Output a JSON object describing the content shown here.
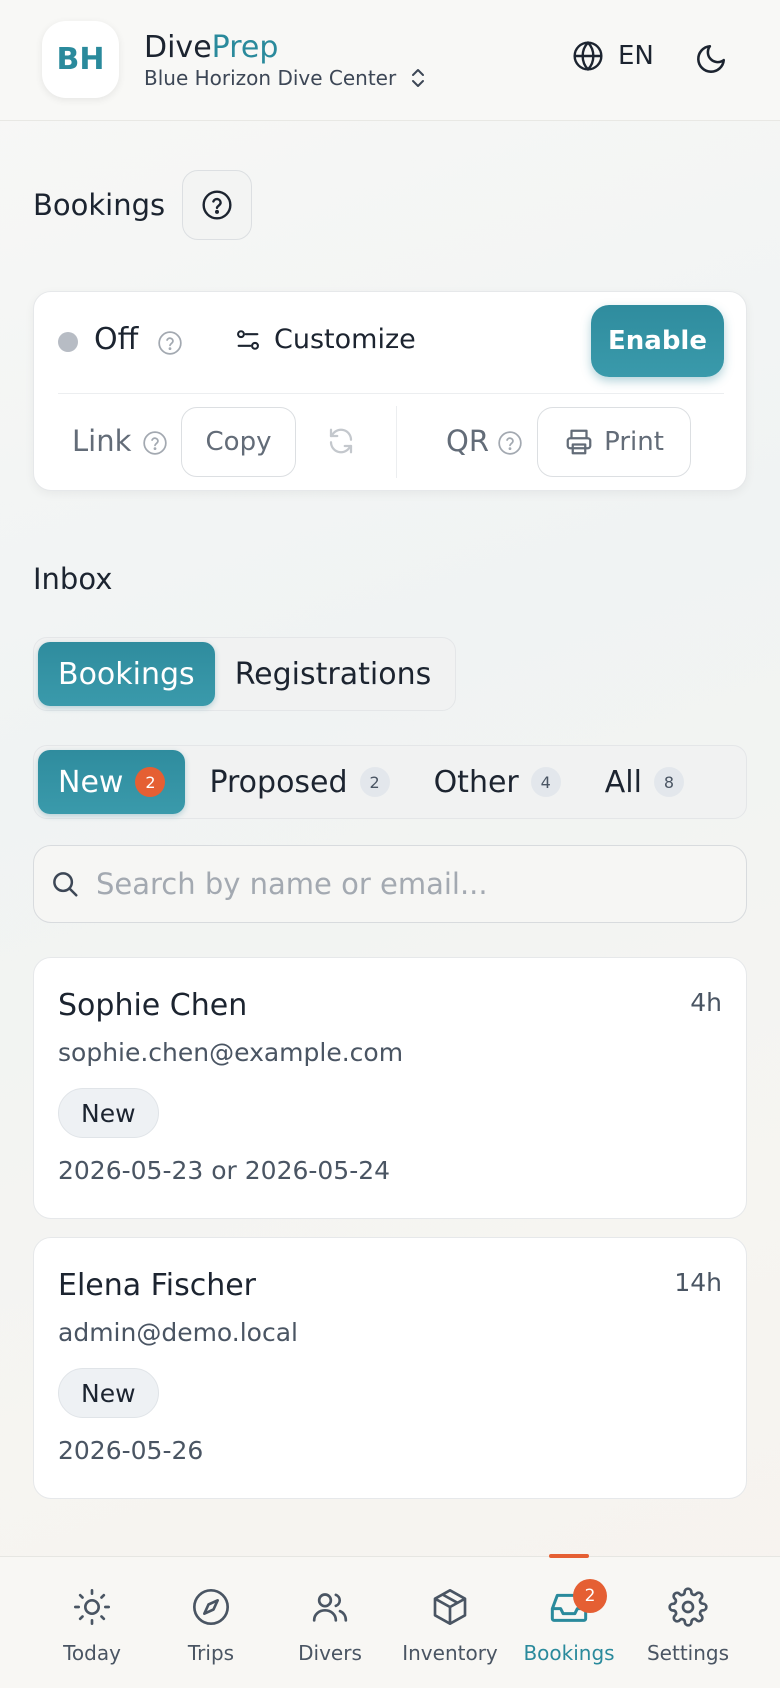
{
  "header": {
    "logo_initials": "BH",
    "app_name_part1": "Dive",
    "app_name_part2": "Prep",
    "center_name": "Blue Horizon Dive Center",
    "language": "EN"
  },
  "page": {
    "title": "Bookings"
  },
  "settings_card": {
    "status_label": "Off",
    "customize_label": "Customize",
    "enable_label": "Enable",
    "link_label": "Link",
    "copy_label": "Copy",
    "qr_label": "QR",
    "print_label": "Print"
  },
  "inbox": {
    "title": "Inbox",
    "tabs": [
      {
        "label": "Bookings",
        "active": true
      },
      {
        "label": "Registrations",
        "active": false
      }
    ],
    "filters": [
      {
        "label": "New",
        "count": "2",
        "active": true
      },
      {
        "label": "Proposed",
        "count": "2",
        "active": false
      },
      {
        "label": "Other",
        "count": "4",
        "active": false
      },
      {
        "label": "All",
        "count": "8",
        "active": false
      }
    ],
    "search_placeholder": "Search by name or email...",
    "bookings": [
      {
        "name": "Sophie Chen",
        "email": "sophie.chen@example.com",
        "time": "4h",
        "status": "New",
        "dates": "2026-05-23 or 2026-05-24"
      },
      {
        "name": "Elena Fischer",
        "email": "admin@demo.local",
        "time": "14h",
        "status": "New",
        "dates": "2026-05-26"
      }
    ]
  },
  "nav": {
    "items": [
      {
        "label": "Today",
        "icon": "sun-icon"
      },
      {
        "label": "Trips",
        "icon": "compass-icon"
      },
      {
        "label": "Divers",
        "icon": "users-icon"
      },
      {
        "label": "Inventory",
        "icon": "box-icon"
      },
      {
        "label": "Bookings",
        "icon": "inbox-icon",
        "active": true,
        "badge": "2"
      },
      {
        "label": "Settings",
        "icon": "gear-icon"
      }
    ]
  },
  "colors": {
    "accent": "#2a8a9c",
    "alert": "#e55f33"
  }
}
